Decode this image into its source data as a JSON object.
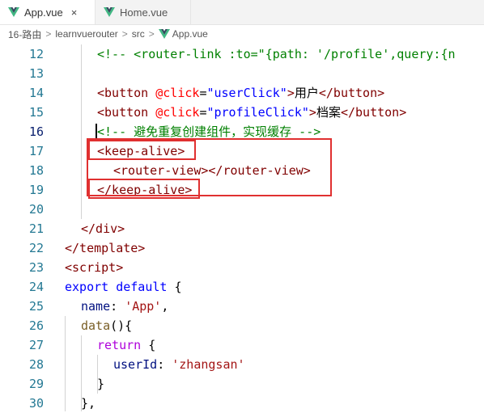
{
  "tabs": [
    {
      "label": "App.vue",
      "close": "×"
    },
    {
      "label": "Home.vue"
    }
  ],
  "breadcrumb": [
    "16-路由",
    "learnvuerouter",
    "src",
    "App.vue"
  ],
  "breadcrumb_sep": ">",
  "colors": {
    "accent_box": "#e03030",
    "vue_green": "#41b883",
    "line_number": "#237893"
  },
  "lines": [
    {
      "n": "12"
    },
    {
      "n": "13"
    },
    {
      "n": "14"
    },
    {
      "n": "15"
    },
    {
      "n": "16"
    },
    {
      "n": "17"
    },
    {
      "n": "18"
    },
    {
      "n": "19"
    },
    {
      "n": "20"
    },
    {
      "n": "21"
    },
    {
      "n": "22"
    },
    {
      "n": "23"
    },
    {
      "n": "24"
    },
    {
      "n": "25"
    },
    {
      "n": "26"
    },
    {
      "n": "27"
    },
    {
      "n": "28"
    },
    {
      "n": "29"
    },
    {
      "n": "30"
    }
  ],
  "code": {
    "l12": "<!-- <router-link :to=\"{path: '/profile',query:{n",
    "l14": {
      "open": "<button ",
      "attr": "@click",
      "eq": "=",
      "val": "\"userClick\"",
      "gt": ">",
      "text": "用户",
      "close": "</button>"
    },
    "l15": {
      "open": "<button ",
      "attr": "@click",
      "eq": "=",
      "val": "\"profileClick\"",
      "gt": ">",
      "text": "档案",
      "close": "</button>"
    },
    "l16": "<!-- 避免重复创建组件，实现缓存 -->",
    "l17": "<keep-alive>",
    "l18": "<router-view></router-view>",
    "l19": "</keep-alive>",
    "l21": "</div>",
    "l22": "</template>",
    "l23": "<script>",
    "l24": {
      "kw1": "export",
      "kw2": "default",
      "rest": " {"
    },
    "l25": {
      "prop": "name",
      "colon": ": ",
      "str": "'App'",
      "comma": ","
    },
    "l26": {
      "prop": "data",
      "rest": "(){"
    },
    "l27": {
      "kw": "return",
      "rest": " {"
    },
    "l28": {
      "prop": "userId",
      "colon": ": ",
      "str": "'zhangsan'"
    },
    "l29": "}",
    "l30": "},"
  }
}
